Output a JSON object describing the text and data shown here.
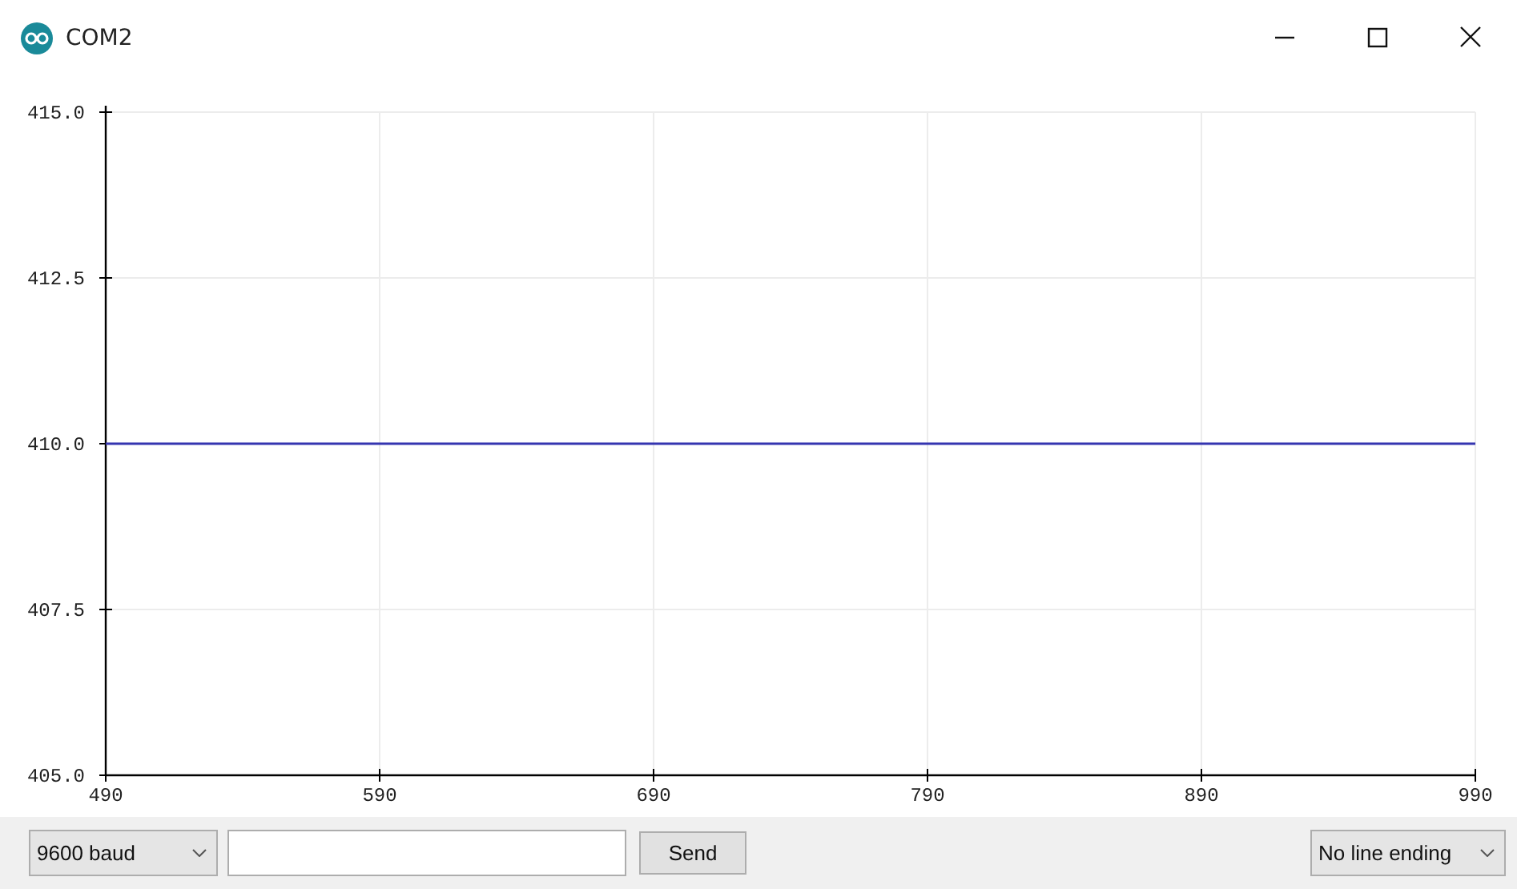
{
  "window": {
    "title": "COM2"
  },
  "plot": {
    "chart_data": {
      "type": "line",
      "grid": true,
      "x": [
        490,
        990
      ],
      "series": [
        {
          "color": "#3535b0",
          "values": [
            410,
            410
          ]
        }
      ],
      "xlim": [
        490,
        990
      ],
      "ylim": [
        405,
        415
      ],
      "xticks": [
        490,
        590,
        690,
        790,
        890,
        990
      ],
      "yticks": [
        {
          "value": 405,
          "label": "405.0"
        },
        {
          "value": 407.5,
          "label": "407.5"
        },
        {
          "value": 410,
          "label": "410.0"
        },
        {
          "value": 412.5,
          "label": "412.5"
        },
        {
          "value": 415,
          "label": "415.0"
        }
      ]
    }
  },
  "controls": {
    "baud": {
      "value": "9600 baud"
    },
    "send": {
      "label": "Send"
    },
    "line_ending": {
      "value": "No line ending"
    }
  }
}
